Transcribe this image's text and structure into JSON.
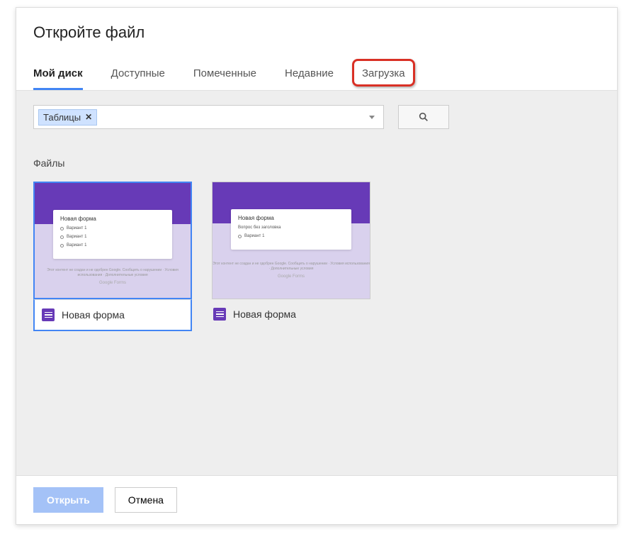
{
  "dialog": {
    "title": "Откройте файл"
  },
  "tabs": [
    {
      "label": "Мой диск",
      "active": true
    },
    {
      "label": "Доступные"
    },
    {
      "label": "Помеченные"
    },
    {
      "label": "Недавние"
    },
    {
      "label": "Загрузка",
      "highlighted": true
    }
  ],
  "filter": {
    "chip_label": "Таблицы"
  },
  "content": {
    "section_label": "Файлы",
    "files": [
      {
        "name": "Новая форма",
        "selected": true,
        "thumb_title": "Новая форма",
        "thumb_options": [
          "Вариант 1",
          "Вариант 1",
          "Вариант 1"
        ],
        "thumb_brand": "Google Forms"
      },
      {
        "name": "Новая форма",
        "selected": false,
        "thumb_title": "Новая форма",
        "thumb_subtitle": "Вопрос без заголовка",
        "thumb_options": [
          "Вариант 1"
        ],
        "thumb_brand": "Google Forms"
      }
    ]
  },
  "footer": {
    "open_label": "Открыть",
    "cancel_label": "Отмена"
  }
}
